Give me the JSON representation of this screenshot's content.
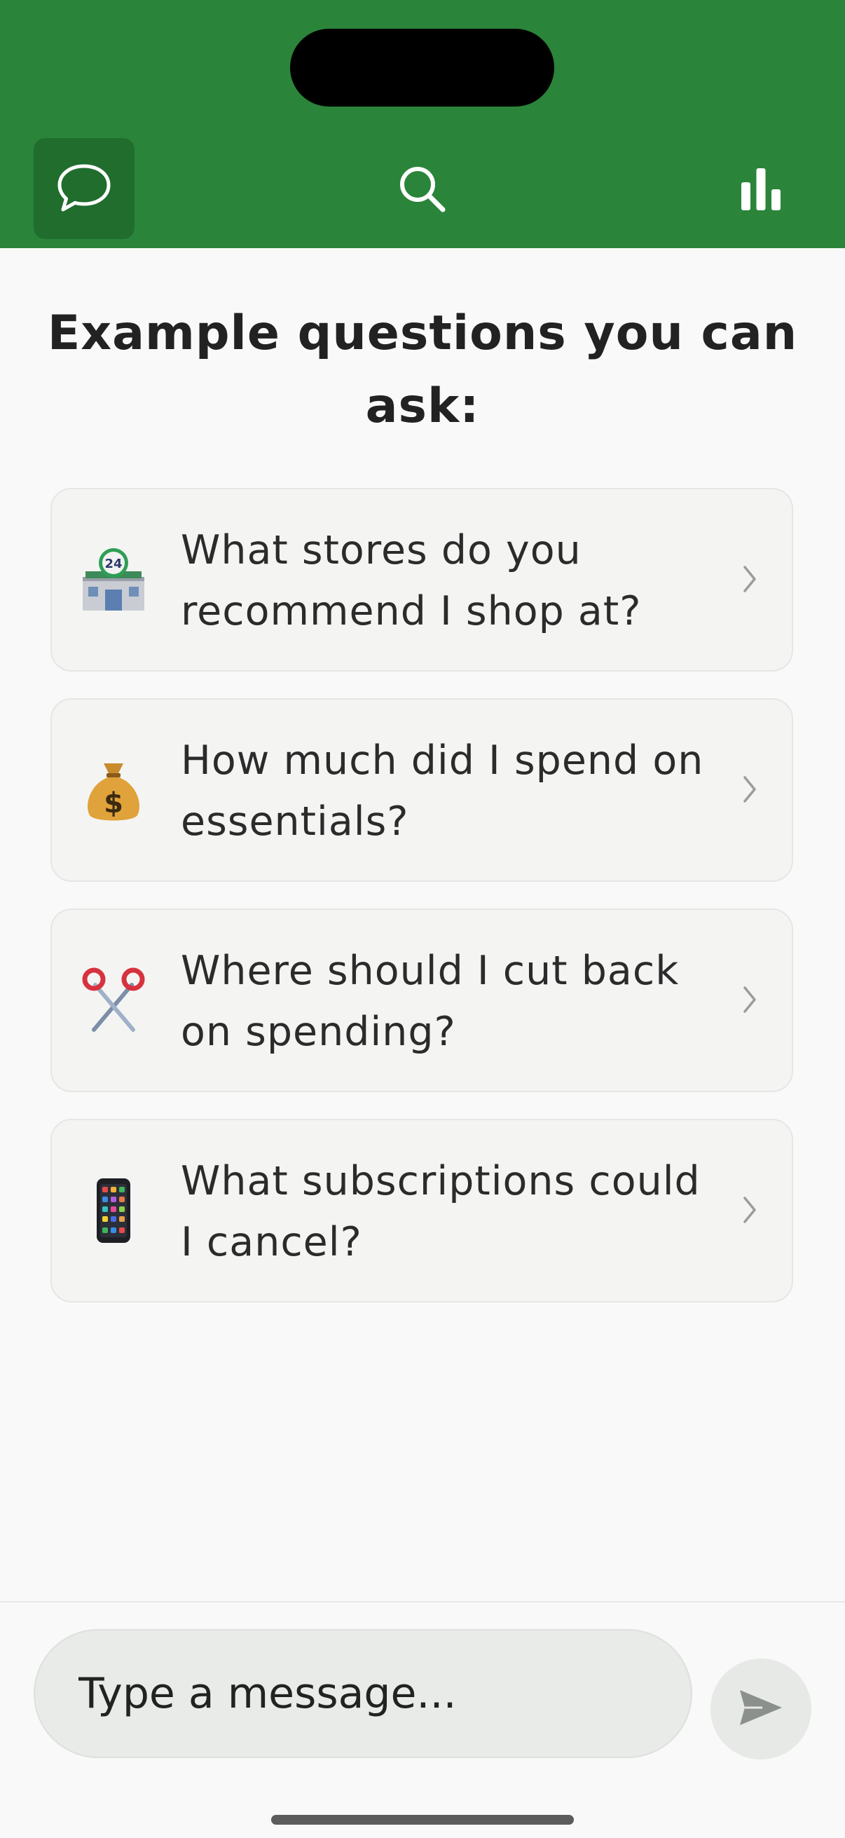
{
  "header": {
    "tabs": [
      {
        "icon": "chat-bubble-icon",
        "active": true
      },
      {
        "icon": "search-icon",
        "active": false
      },
      {
        "icon": "bar-chart-icon",
        "active": false
      }
    ],
    "colors": {
      "brand_green": "#2a843a",
      "active_tab": "#206d2e"
    }
  },
  "main": {
    "title": "Example questions you can ask:",
    "questions": [
      {
        "emoji": "🏪",
        "icon": "convenience-store-icon",
        "text": "What stores do you recommend I shop at?"
      },
      {
        "emoji": "💰",
        "icon": "money-bag-icon",
        "text": "How much did I spend on essentials?"
      },
      {
        "emoji": "✂️",
        "icon": "scissors-icon",
        "text": "Where should I cut back on spending?"
      },
      {
        "emoji": "📱",
        "icon": "mobile-phone-icon",
        "text": "What subscriptions could I cancel?"
      }
    ]
  },
  "composer": {
    "input_value": "",
    "placeholder": "Type a message...",
    "send_icon": "send-icon"
  }
}
